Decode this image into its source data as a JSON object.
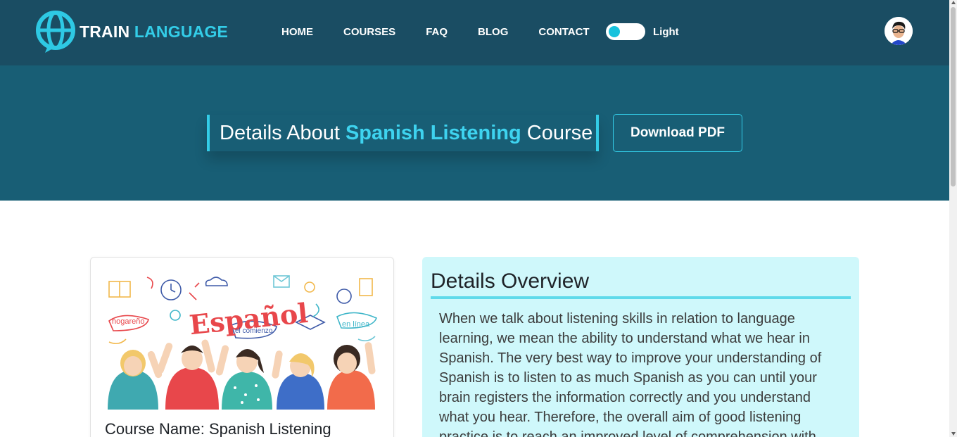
{
  "brand": {
    "word1": "TRAIN",
    "word2": "LANGUAGE"
  },
  "nav": {
    "items": [
      {
        "label": "HOME"
      },
      {
        "label": "COURSES"
      },
      {
        "label": "FAQ"
      },
      {
        "label": "BLOG"
      },
      {
        "label": "CONTACT"
      }
    ],
    "theme_label": "Light"
  },
  "hero": {
    "title_prefix": "Details About",
    "title_highlight": "Spanish Listening",
    "title_suffix": "Course",
    "download_label": "Download PDF"
  },
  "course_card": {
    "image_text": {
      "title": "Español",
      "tag1": "hogareño",
      "tag2": "el comienzo",
      "tag3": "en línea"
    },
    "title": "Course Name: Spanish Listening"
  },
  "details": {
    "heading": "Details Overview",
    "body": "When we talk about listening skills in relation to language learning, we mean the ability to understand what we hear in Spanish. The very best way to improve your understanding of Spanish is to listen to as much Spanish as you can until your brain registers the information correctly and you understand what you hear. Therefore, the overall aim of good listening practice is to reach an improved level of comprehension with"
  },
  "colors": {
    "navbar": "#1a4d63",
    "hero": "#185e75",
    "accent": "#33cde8",
    "details_bg": "#cff8fb"
  }
}
